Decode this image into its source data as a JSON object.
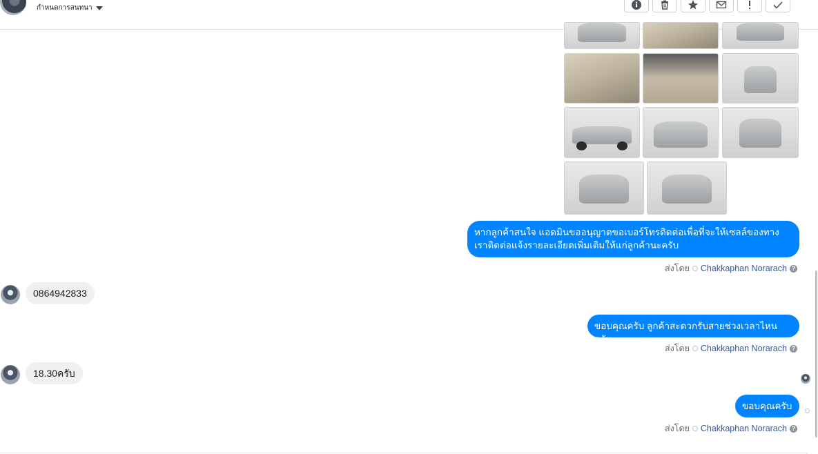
{
  "header": {
    "title": "กำหนดการสนทนา",
    "toolbar": [
      {
        "icon": "info-icon",
        "label": "i"
      },
      {
        "icon": "trash-icon",
        "label": ""
      },
      {
        "icon": "star-icon",
        "label": "★"
      },
      {
        "icon": "envelope-icon",
        "label": "✉"
      },
      {
        "icon": "exclamation-icon",
        "label": "!"
      },
      {
        "icon": "check-icon",
        "label": "✓"
      }
    ]
  },
  "messages": {
    "out1": "หากลูกค้าสนใจ แอดมินขออนุญาตขอเบอร์โทรติดต่อเพื่อที่จะให้เซลล์ของทางเราติดต่อแจ้งรายละเอียดเพิ่มเติมให้แก่ลูกค้านะครับ",
    "in1": "0864942833",
    "out2": "ขอบคุณครับ ลูกค้าสะดวกรับสายช่วงเวลาไหนครับ",
    "in2": "18.30ครับ",
    "out3": "ขอบคุณครับ"
  },
  "sent_by": {
    "prefix": "ส่งโดย",
    "name": "Chakkaphan Norarach"
  }
}
